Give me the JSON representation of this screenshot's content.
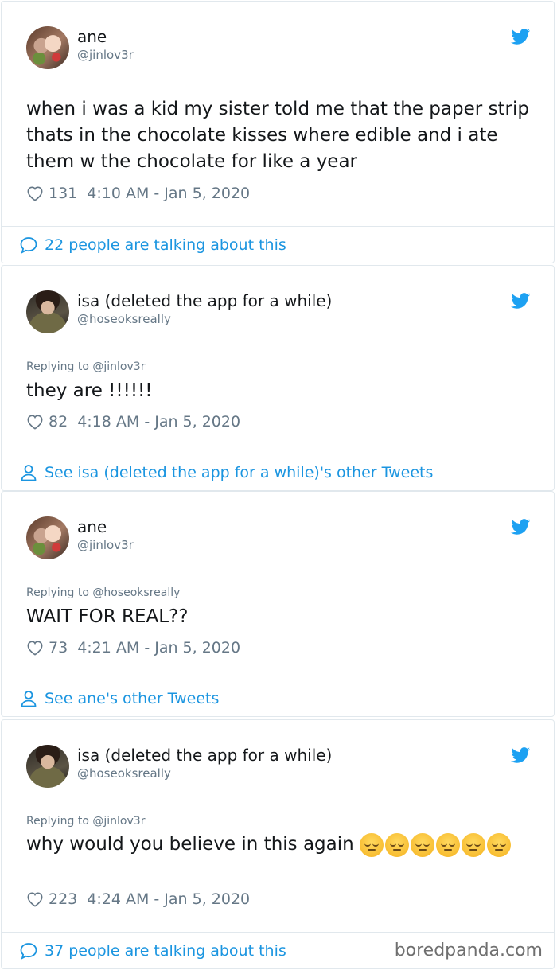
{
  "tweets": [
    {
      "name": "ane",
      "handle": "@jinlov3r",
      "text": "when i was a kid my sister told me that the paper strip thats in the chocolate kisses where edible and i ate them w the chocolate for like a year",
      "likes": "131",
      "timestamp": "4:10 AM - Jan 5, 2020",
      "footer": "22 people are talking about this"
    },
    {
      "name": "isa (deleted the app for a while)",
      "handle": "@hoseoksreally",
      "replying_prefix": "Replying to ",
      "replying_to": "@jinlov3r",
      "text": "they are !!!!!!",
      "likes": "82",
      "timestamp": "4:18 AM - Jan 5, 2020",
      "footer": "See isa (deleted the app for a while)'s other Tweets"
    },
    {
      "name": "ane",
      "handle": "@jinlov3r",
      "replying_prefix": "Replying to ",
      "replying_to": "@hoseoksreally",
      "text": "WAIT FOR REAL??",
      "likes": "73",
      "timestamp": "4:21 AM - Jan 5, 2020",
      "footer": "See ane's other Tweets"
    },
    {
      "name": "isa (deleted the app for a while)",
      "handle": "@hoseoksreally",
      "replying_prefix": "Replying to ",
      "replying_to": "@jinlov3r",
      "text": "why would you believe in this again",
      "emoji": "pensive-face-emoji",
      "emoji_count": 6,
      "likes": "223",
      "timestamp": "4:24 AM - Jan 5, 2020",
      "footer": "37 people are talking about this"
    }
  ],
  "watermark": "boredpanda.com",
  "icons": {
    "bird": "twitter-bird-icon",
    "like": "heart-icon",
    "talk": "speech-bubble-icon",
    "profile": "person-icon"
  },
  "colors": {
    "accent": "#1b95e0",
    "muted": "#657786",
    "text": "#14171a",
    "border": "#e1e8ed"
  }
}
